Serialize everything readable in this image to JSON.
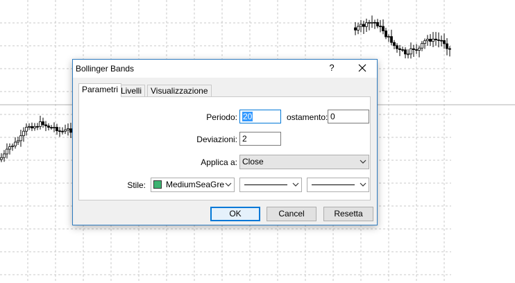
{
  "dialog": {
    "title": "Bollinger Bands",
    "help_label": "?"
  },
  "tabs": [
    "Parametri",
    "Livelli",
    "Visualizzazione"
  ],
  "params": {
    "periodo_label": "Periodo:",
    "periodo_value": "20",
    "spostamento_label": "ostamento:",
    "spostamento_value": "0",
    "deviazioni_label": "Deviazioni:",
    "deviazioni_value": "2",
    "applica_label": "Applica a:",
    "applica_value": "Close",
    "stile_label": "Stile:",
    "color_name": "MediumSeaGre",
    "color_hex": "#3cb371"
  },
  "buttons": {
    "ok": "OK",
    "cancel": "Cancel",
    "reset": "Resetta"
  }
}
